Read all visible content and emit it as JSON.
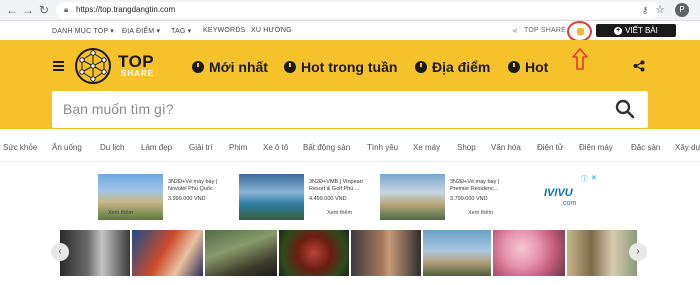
{
  "browser": {
    "url": "https://top.trangdangtin.com",
    "profile_letter": "P"
  },
  "topmenu": {
    "items": [
      "DANH MỤC TOP ▾",
      "ĐỊA ĐIỂM ▾",
      "TAG ▾",
      "KEYWORDS",
      "XU HƯỚNG"
    ],
    "share_label": "TOP SHARE",
    "write_label": "VIẾT BÀI"
  },
  "logo": {
    "top": "TOP",
    "share": "SHARE"
  },
  "nav": [
    "Mới nhất",
    "Hot trong tuần",
    "Địa điểm",
    "Hot"
  ],
  "search": {
    "placeholder": "Bạn muốn tìm gì?"
  },
  "categories": [
    "Sức khỏe",
    "Ăn uống",
    "Du lịch",
    "Làm đẹp",
    "Giải trí",
    "Phim",
    "Xe ô tô",
    "Bất động sản",
    "Tình yêu",
    "Xe máy",
    "Shop",
    "Văn hóa",
    "Điện tử",
    "Điện máy",
    "Đặc sản",
    "Xây dựng"
  ],
  "ads": [
    {
      "line1": "3N2Đ+Vé máy bay |",
      "line2": "Novotel Phú Quốc",
      "price": "3.999.000 VND",
      "cta": "Xem thêm"
    },
    {
      "line1": "3N2Đ+VMB | Vinpearl",
      "line2": "Resort & Golf Phú ...",
      "price": "4.499.000 VND",
      "cta": "Xem thêm"
    },
    {
      "line1": "3N2Đ+Vé máy bay |",
      "line2": "Premier Residenc...",
      "price": "3.799.000 VND",
      "cta": "Xem thêm"
    }
  ],
  "ad_brand": "IVIVU",
  "ad_brand_sub": ".com",
  "colors": {
    "header_yellow": "#f5c22b",
    "dark": "#1a1a1a",
    "highlight_red": "#e53935"
  }
}
